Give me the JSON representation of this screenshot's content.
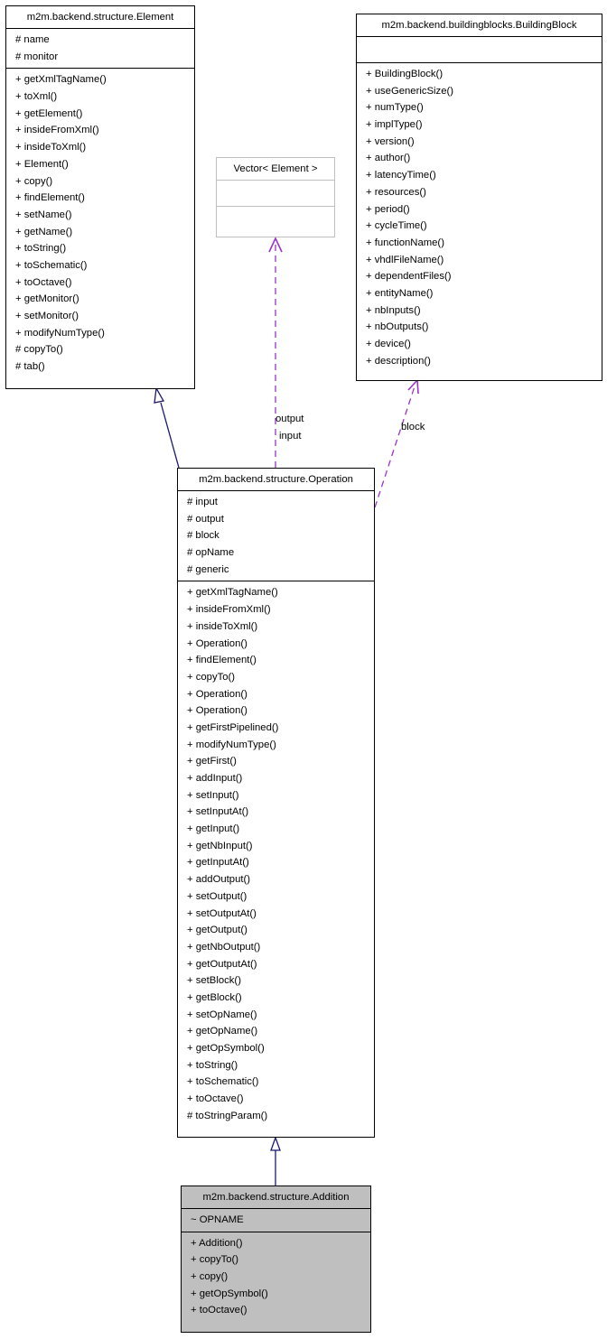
{
  "diagram": {
    "classes": {
      "element": {
        "name": "m2m.backend.structure.Element",
        "attributes": [
          "# name",
          "# monitor"
        ],
        "methods": [
          "+ getXmlTagName()",
          "+ toXml()",
          "+ getElement()",
          "+ insideFromXml()",
          "+ insideToXml()",
          "+ Element()",
          "+ copy()",
          "+ findElement()",
          "+ setName()",
          "+ getName()",
          "+ toString()",
          "+ toSchematic()",
          "+ toOctave()",
          "+ getMonitor()",
          "+ setMonitor()",
          "+ modifyNumType()",
          "# copyTo()",
          "# tab()"
        ]
      },
      "vector": {
        "name": "Vector< Element >",
        "attributes": [],
        "methods": []
      },
      "building_block": {
        "name": "m2m.backend.buildingblocks.BuildingBlock",
        "attributes": [],
        "methods": [
          "+ BuildingBlock()",
          "+ useGenericSize()",
          "+ numType()",
          "+ implType()",
          "+ version()",
          "+ author()",
          "+ latencyTime()",
          "+ resources()",
          "+ period()",
          "+ cycleTime()",
          "+ functionName()",
          "+ vhdlFileName()",
          "+ dependentFiles()",
          "+ entityName()",
          "+ nbInputs()",
          "+ nbOutputs()",
          "+ device()",
          "+ description()"
        ]
      },
      "operation": {
        "name": "m2m.backend.structure.Operation",
        "attributes": [
          "# input",
          "# output",
          "# block",
          "# opName",
          "# generic"
        ],
        "methods": [
          "+ getXmlTagName()",
          "+ insideFromXml()",
          "+ insideToXml()",
          "+ Operation()",
          "+ findElement()",
          "+ copyTo()",
          "+ Operation()",
          "+ Operation()",
          "+ getFirstPipelined()",
          "+ modifyNumType()",
          "+ getFirst()",
          "+ addInput()",
          "+ setInput()",
          "+ setInputAt()",
          "+ getInput()",
          "+ getNbInput()",
          "+ getInputAt()",
          "+ addOutput()",
          "+ setOutput()",
          "+ setOutputAt()",
          "+ getOutput()",
          "+ getNbOutput()",
          "+ getOutputAt()",
          "+ setBlock()",
          "+ getBlock()",
          "+ setOpName()",
          "+ getOpName()",
          "+ getOpSymbol()",
          "+ toString()",
          "+ toSchematic()",
          "+ toOctave()",
          "# toStringParam()"
        ]
      },
      "addition": {
        "name": "m2m.backend.structure.Addition",
        "attributes": [
          "~ OPNAME"
        ],
        "methods": [
          "+ Addition()",
          "+ copyTo()",
          "+ copy()",
          "+ getOpSymbol()",
          "+ toOctave()"
        ]
      }
    },
    "edges": [
      {
        "from": "operation",
        "to": "element",
        "type": "inheritance",
        "label": ""
      },
      {
        "from": "addition",
        "to": "operation",
        "type": "inheritance",
        "label": ""
      },
      {
        "from": "operation",
        "to": "vector",
        "type": "usage",
        "label": "output\ninput"
      },
      {
        "from": "operation",
        "to": "building_block",
        "type": "usage",
        "label": "block"
      }
    ],
    "edge_labels": {
      "vector_output": "output",
      "vector_input": "input",
      "block": "block"
    },
    "colors": {
      "inheritance": "#191970",
      "usage": "#9a32cd",
      "highlight_fill": "#bfbfbf",
      "template_border": "#bfbfbf"
    }
  }
}
